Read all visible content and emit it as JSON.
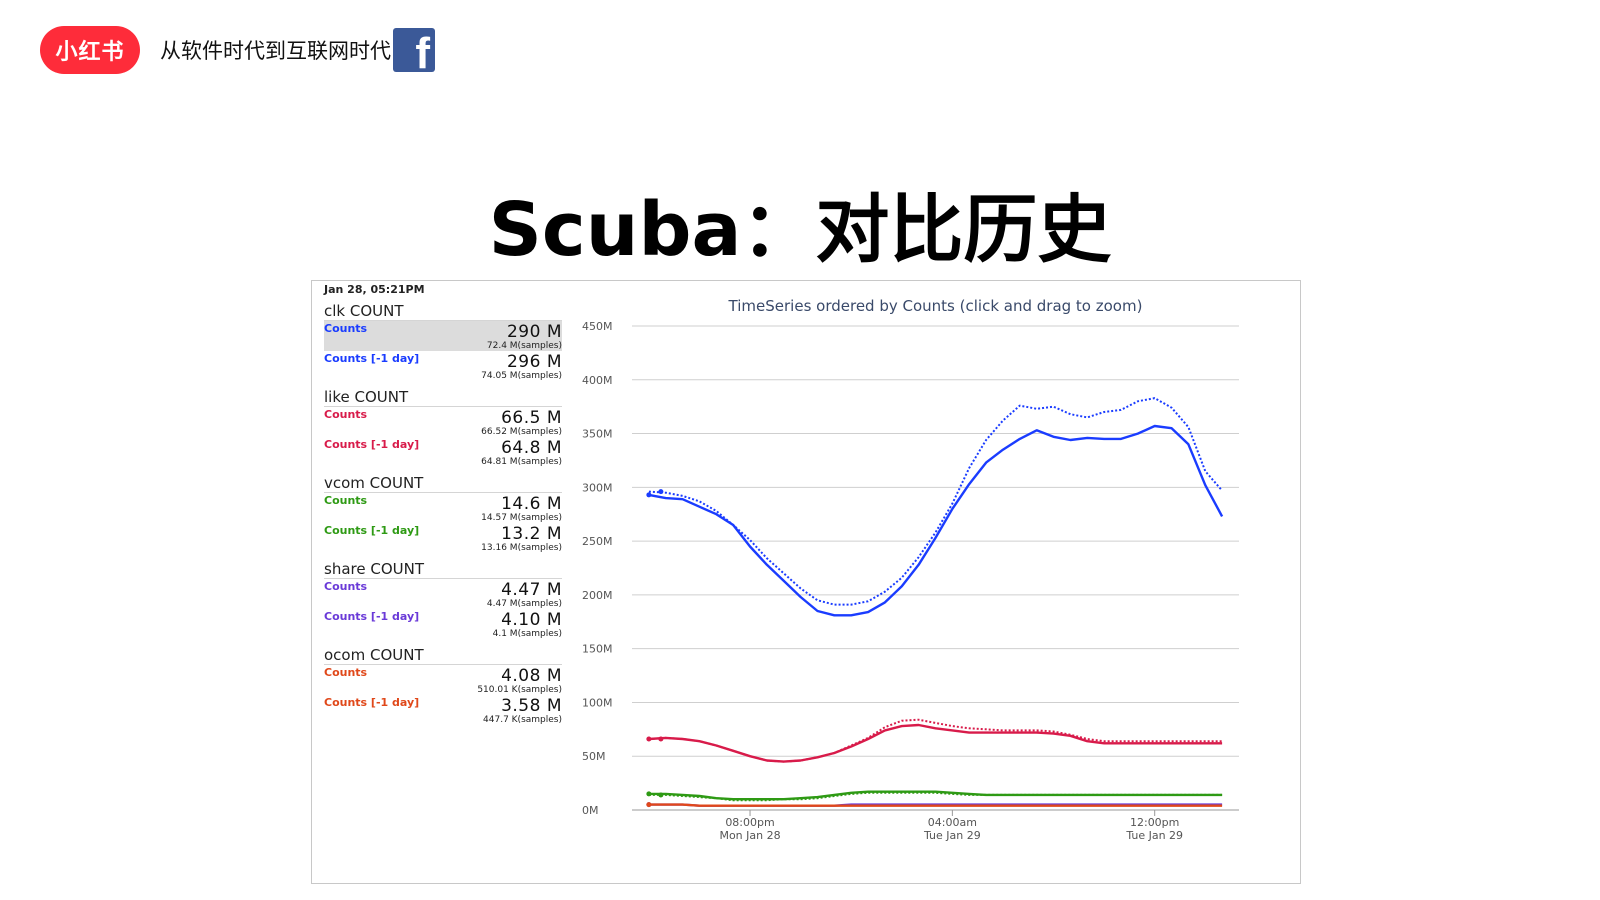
{
  "header": {
    "logo_text": "小红书",
    "subtitle": "从软件时代到互联网时代",
    "fb_icon": "f"
  },
  "slide": {
    "title": "Scuba：对比历史"
  },
  "panel": {
    "timestamp": "Jan 28, 05:21PM",
    "metrics": [
      {
        "title": "clk COUNT",
        "color": "#1a3cff",
        "highlight": true,
        "rows": [
          {
            "label": "Counts",
            "value": "290 M",
            "samples": "72.4 M(samples)"
          },
          {
            "label": "Counts [-1 day]",
            "value": "296 M",
            "samples": "74.05 M(samples)"
          }
        ]
      },
      {
        "title": "like COUNT",
        "color": "#d81b4a",
        "highlight": false,
        "rows": [
          {
            "label": "Counts",
            "value": "66.5 M",
            "samples": "66.52 M(samples)"
          },
          {
            "label": "Counts [-1 day]",
            "value": "64.8 M",
            "samples": "64.81 M(samples)"
          }
        ]
      },
      {
        "title": "vcom COUNT",
        "color": "#2e9a14",
        "highlight": false,
        "rows": [
          {
            "label": "Counts",
            "value": "14.6 M",
            "samples": "14.57 M(samples)"
          },
          {
            "label": "Counts [-1 day]",
            "value": "13.2 M",
            "samples": "13.16 M(samples)"
          }
        ]
      },
      {
        "title": "share COUNT",
        "color": "#6a3ad8",
        "highlight": false,
        "rows": [
          {
            "label": "Counts",
            "value": "4.47 M",
            "samples": "4.47 M(samples)"
          },
          {
            "label": "Counts [-1 day]",
            "value": "4.10 M",
            "samples": "4.1 M(samples)"
          }
        ]
      },
      {
        "title": "ocom COUNT",
        "color": "#e0481a",
        "highlight": false,
        "rows": [
          {
            "label": "Counts",
            "value": "4.08 M",
            "samples": "510.01 K(samples)"
          },
          {
            "label": "Counts [-1 day]",
            "value": "3.58 M",
            "samples": "447.7 K(samples)"
          }
        ]
      }
    ]
  },
  "chart_data": {
    "type": "line",
    "title": "TimeSeries ordered by Counts (click and drag to zoom)",
    "xlabel": "",
    "ylabel": "",
    "ylim": [
      0,
      450
    ],
    "y_ticks": [
      "0M",
      "50M",
      "100M",
      "150M",
      "200M",
      "250M",
      "300M",
      "350M",
      "400M",
      "450M"
    ],
    "y_tick_values": [
      0,
      50,
      100,
      150,
      200,
      250,
      300,
      350,
      400,
      450
    ],
    "xlim": [
      -1.5,
      16.5
    ],
    "x_tick_values": [
      2,
      8,
      14
    ],
    "x_ticks": [
      {
        "time": "08:00pm",
        "date": "Mon Jan 28"
      },
      {
        "time": "04:00am",
        "date": "Tue Jan 29"
      },
      {
        "time": "12:00pm",
        "date": "Tue Jan 29"
      }
    ],
    "grid": true,
    "x": [
      -1,
      -0.5,
      0,
      0.5,
      1,
      1.5,
      2,
      2.5,
      3,
      3.5,
      4,
      4.5,
      5,
      5.5,
      6,
      6.5,
      7,
      7.5,
      8,
      8.5,
      9,
      9.5,
      10,
      10.5,
      11,
      11.5,
      12,
      12.5,
      13,
      13.5,
      14,
      14.5,
      15,
      15.5,
      16
    ],
    "series": [
      {
        "color": "#1a3cff",
        "style": "solid",
        "values": [
          293,
          290,
          289,
          282,
          275,
          265,
          245,
          228,
          213,
          198,
          185,
          181,
          181,
          184,
          193,
          208,
          228,
          253,
          280,
          303,
          323,
          335,
          345,
          353,
          347,
          344,
          346,
          345,
          345,
          350,
          357,
          355,
          340,
          302,
          273
        ]
      },
      {
        "color": "#1a3cff",
        "style": "dotted",
        "values": [
          296,
          295,
          292,
          287,
          278,
          265,
          251,
          234,
          220,
          206,
          195,
          191,
          191,
          194,
          203,
          216,
          235,
          258,
          285,
          318,
          344,
          362,
          376,
          373,
          375,
          368,
          365,
          370,
          372,
          380,
          383,
          374,
          356,
          315,
          297
        ]
      },
      {
        "color": "#d81b4a",
        "style": "solid",
        "values": [
          66,
          67,
          66,
          64,
          60,
          55,
          50,
          46,
          45,
          46,
          49,
          53,
          59,
          66,
          74,
          78,
          79,
          76,
          74,
          72,
          72,
          72,
          72,
          72,
          71,
          69,
          64,
          62,
          62,
          62,
          62,
          62,
          62,
          62,
          62
        ]
      },
      {
        "color": "#d81b4a",
        "style": "dotted",
        "values": [
          66,
          67,
          66,
          64,
          60,
          55,
          50,
          46,
          45,
          46,
          49,
          53,
          60,
          67,
          77,
          83,
          84,
          81,
          78,
          76,
          75,
          74,
          74,
          74,
          73,
          70,
          66,
          64,
          64,
          64,
          64,
          64,
          64,
          64,
          64
        ]
      },
      {
        "color": "#2e9a14",
        "style": "solid",
        "values": [
          15,
          15,
          14,
          13,
          11,
          10,
          10,
          10,
          10,
          11,
          12,
          14,
          16,
          17,
          17,
          17,
          17,
          17,
          16,
          15,
          14,
          14,
          14,
          14,
          14,
          14,
          14,
          14,
          14,
          14,
          14,
          14,
          14,
          14,
          14
        ]
      },
      {
        "color": "#2e9a14",
        "style": "dotted",
        "values": [
          14,
          14,
          13,
          12,
          11,
          9,
          9,
          9,
          10,
          10,
          11,
          13,
          15,
          16,
          16,
          16,
          16,
          16,
          15,
          14,
          14,
          14,
          14,
          14,
          14,
          14,
          14,
          14,
          14,
          14,
          14,
          14,
          14,
          14,
          14
        ]
      },
      {
        "color": "#6a3ad8",
        "style": "solid",
        "values": [
          5,
          5,
          5,
          4,
          4,
          4,
          4,
          4,
          4,
          4,
          4,
          4,
          5,
          5,
          5,
          5,
          5,
          5,
          5,
          5,
          5,
          5,
          5,
          5,
          5,
          5,
          5,
          5,
          5,
          5,
          5,
          5,
          5,
          5,
          5
        ]
      },
      {
        "color": "#e0481a",
        "style": "solid",
        "values": [
          5,
          5,
          5,
          4,
          4,
          4,
          4,
          4,
          4,
          4,
          4,
          4,
          4,
          4,
          4,
          4,
          4,
          4,
          4,
          4,
          4,
          4,
          4,
          4,
          4,
          4,
          4,
          4,
          4,
          4,
          4,
          4,
          4,
          4,
          4
        ]
      }
    ]
  }
}
